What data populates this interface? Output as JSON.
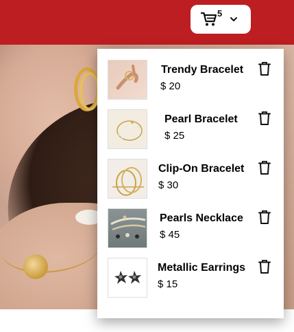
{
  "header": {
    "cart_count": "5",
    "accent_color": "#bd1e21",
    "cart_icon": "cart-icon",
    "dropdown_icon": "chevron-down-icon"
  },
  "cart": {
    "items": [
      {
        "name": "Trendy Bracelet",
        "price": "$ 20",
        "thumb": "bracelet-on-hand"
      },
      {
        "name": "Pearl Bracelet",
        "price": "$ 25",
        "thumb": "pearl-bracelet"
      },
      {
        "name": "Clip-On Bracelet",
        "price": "$ 30",
        "thumb": "gold-bangles"
      },
      {
        "name": "Pearls Necklace",
        "price": "$ 45",
        "thumb": "pearl-necklaces"
      },
      {
        "name": "Metallic Earrings",
        "price": "$ 15",
        "thumb": "star-earrings"
      }
    ],
    "remove_icon": "trash-icon"
  }
}
